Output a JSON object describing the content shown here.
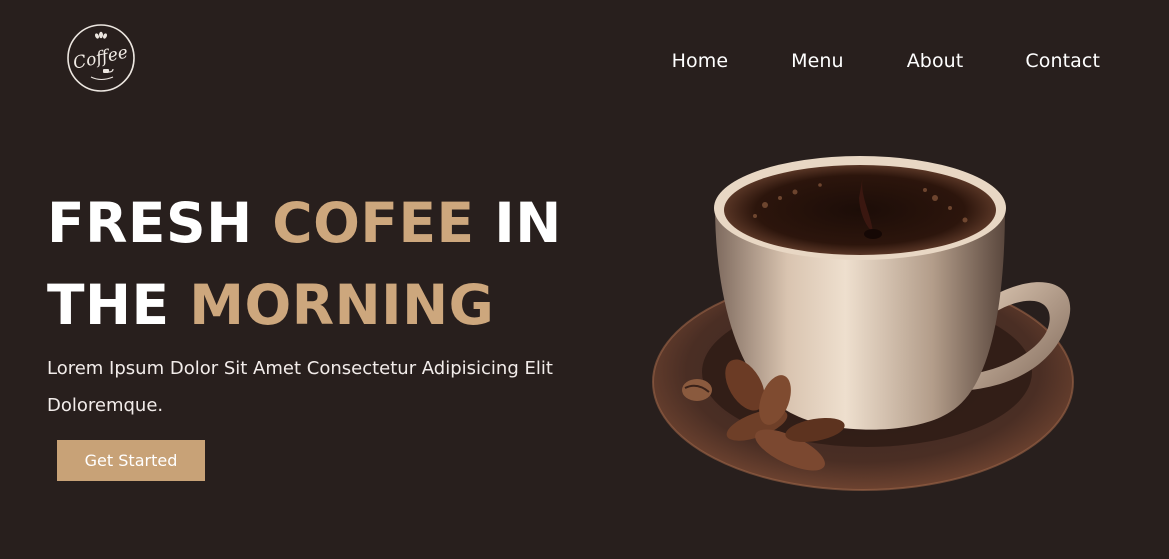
{
  "header": {
    "logo_text": "Coffee",
    "nav": [
      {
        "label": "Home"
      },
      {
        "label": "Menu"
      },
      {
        "label": "About"
      },
      {
        "label": "Contact"
      }
    ]
  },
  "hero": {
    "title_line1_a": "FRESH ",
    "title_line1_b": "COFEE",
    "title_line1_c": " IN",
    "title_line2_a": "THE ",
    "title_line2_b": "MORNING",
    "description": "Lorem Ipsum Dolor Sit Amet Consectetur Adipisicing Elit Doloremque.",
    "cta_label": "Get Started"
  },
  "colors": {
    "background": "#281f1d",
    "accent": "#cda77d",
    "button": "#c8a277"
  },
  "icons": {
    "logo": "coffee-logo-icon",
    "hero_image": "coffee-cup-image"
  }
}
